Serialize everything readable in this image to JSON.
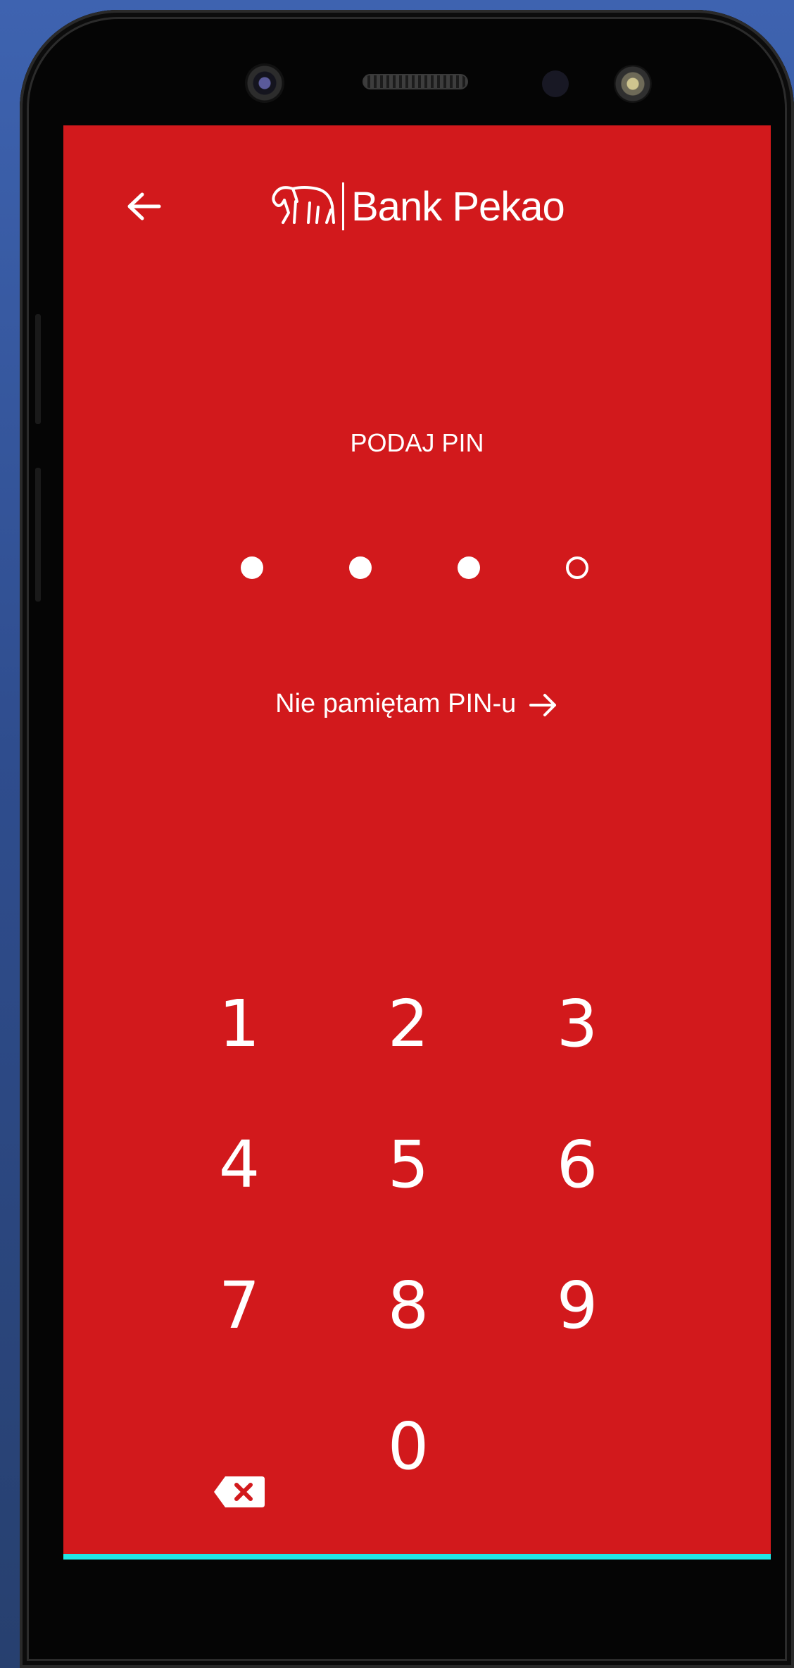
{
  "header": {
    "brand": "Bank Pekao"
  },
  "pin": {
    "prompt": "PODAJ PIN",
    "entered": 3,
    "length": 4,
    "forgot_label": "Nie pamiętam PIN-u"
  },
  "keypad": {
    "keys": [
      "1",
      "2",
      "3",
      "4",
      "5",
      "6",
      "7",
      "8",
      "9",
      "0"
    ]
  },
  "colors": {
    "background": "#d2191c",
    "accent": "#ffffff"
  }
}
